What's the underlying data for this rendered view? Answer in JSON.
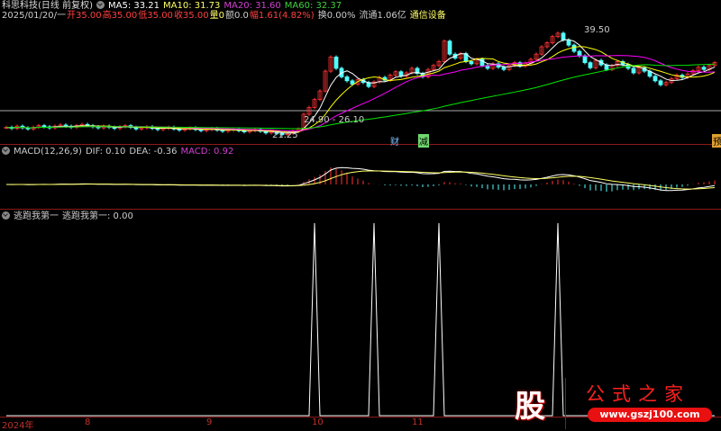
{
  "header": {
    "stock": "科思科技(日线 前复权)",
    "ma5": "MA5: 33.21",
    "ma10": "MA10: 31.73",
    "ma20": "MA20: 31.60",
    "ma60": "MA60: 32.37"
  },
  "quote": {
    "date": "2025/01/20/一",
    "open": "开35.00",
    "high": "高35.00",
    "low": "低35.00",
    "close": "收35.00",
    "vol": "量0",
    "amount": "额0.0",
    "range": "幅1.61(4.82%)",
    "turnover": "换0.00%",
    "float": "流通1.06亿",
    "industry": "通信设备"
  },
  "price_labels": {
    "high": "39.50",
    "low": "21.25",
    "gap": "24.90 - 26.10",
    "cai": "财",
    "jian": "减",
    "yu": "预"
  },
  "macd": {
    "title": "MACD(12,26,9)",
    "dif": "DIF: 0.10",
    "dea": "DEA: -0.36",
    "macd": "MACD: 0.92"
  },
  "indicator": {
    "title": "逃跑我第一",
    "value": "逃跑我第一: 0.00"
  },
  "xaxis": [
    "2024年",
    "8",
    "9",
    "10",
    "11"
  ],
  "logo": {
    "char": "股",
    "name": "公式之家",
    "url": "www.gszj100.com"
  },
  "colors": {
    "up": "#ff3232",
    "down": "#54ffff",
    "ma5": "#ffffff",
    "ma10": "#ffff00",
    "ma20": "#ff00ff",
    "ma60": "#00e600"
  },
  "chart_data": {
    "type": "candlestick",
    "closes": [
      22.6,
      22.4,
      22.8,
      22.5,
      22.3,
      22.6,
      22.9,
      22.7,
      22.5,
      22.8,
      23.0,
      22.8,
      22.6,
      22.9,
      23.1,
      22.9,
      22.7,
      22.5,
      22.8,
      22.6,
      22.4,
      22.7,
      22.9,
      22.6,
      22.3,
      22.5,
      22.7,
      22.4,
      22.2,
      22.4,
      22.6,
      22.3,
      22.1,
      22.3,
      22.5,
      22.2,
      22.0,
      22.2,
      22.4,
      22.1,
      21.9,
      22.1,
      22.3,
      22.0,
      21.8,
      22.0,
      22.2,
      21.9,
      21.6,
      21.8,
      21.5,
      21.3,
      21.6,
      21.9,
      22.3,
      24.9,
      26.1,
      27.5,
      29.0,
      32.5,
      35.0,
      33.0,
      31.5,
      30.8,
      30.2,
      31.0,
      30.5,
      29.8,
      30.6,
      31.4,
      30.9,
      31.8,
      32.4,
      31.6,
      32.2,
      33.0,
      32.1,
      31.5,
      32.8,
      33.5,
      34.2,
      37.8,
      35.5,
      34.8,
      35.6,
      34.2,
      33.8,
      34.6,
      33.5,
      33.0,
      33.8,
      33.2,
      32.8,
      33.5,
      34.0,
      33.4,
      33.9,
      34.6,
      35.5,
      36.8,
      37.5,
      38.6,
      39.2,
      38.0,
      37.1,
      36.0,
      35.2,
      34.0,
      33.1,
      34.4,
      33.6,
      32.8,
      33.5,
      34.2,
      33.7,
      33.0,
      32.2,
      33.1,
      32.5,
      31.6,
      30.8,
      30.1,
      30.5,
      31.2,
      31.8,
      31.4,
      32.0,
      32.6,
      33.2,
      32.8,
      33.5,
      34.0
    ],
    "signal_days": [
      57,
      68,
      80,
      102
    ],
    "ylim": [
      20.5,
      41
    ]
  }
}
